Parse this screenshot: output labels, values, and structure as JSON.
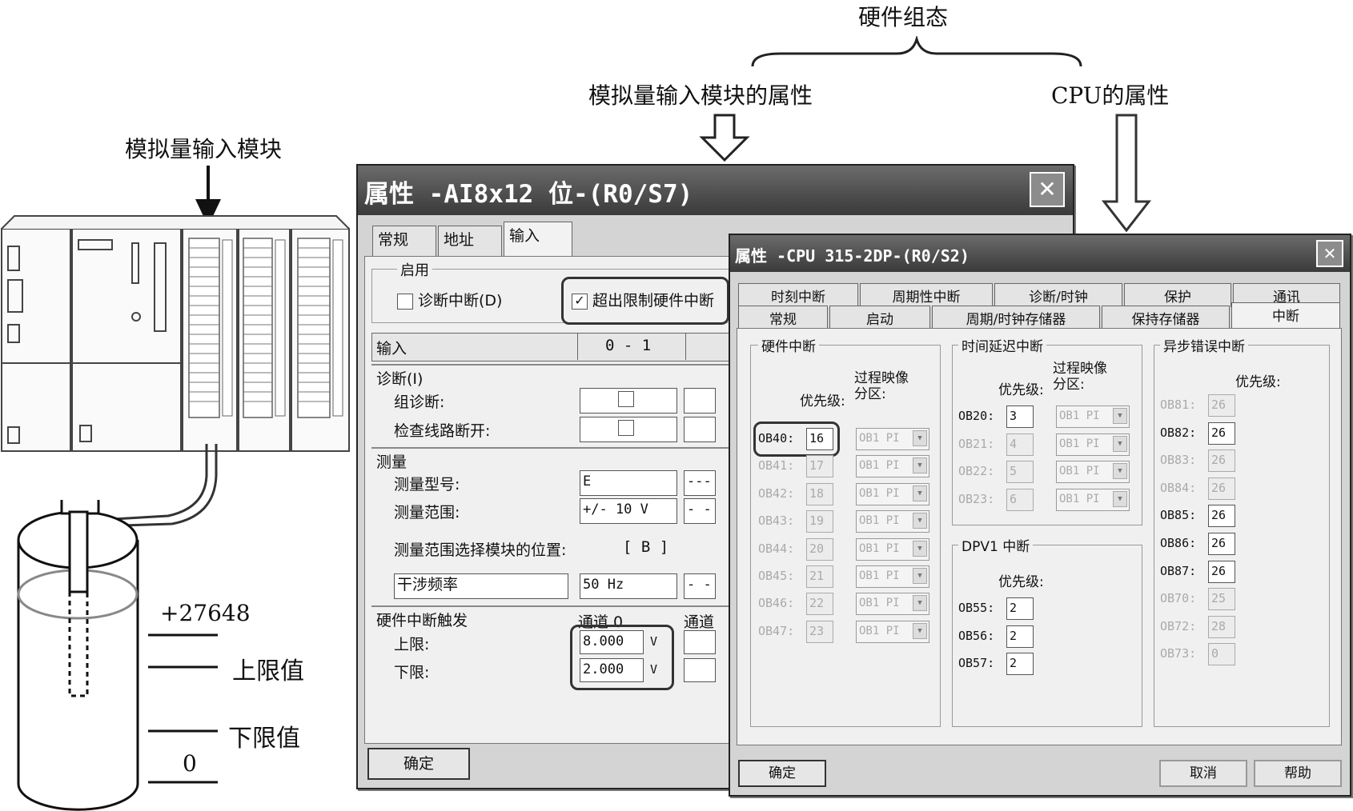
{
  "annotations": {
    "hw_config": "硬件组态",
    "ai_props": "模拟量输入模块的属性",
    "cpu_props": "CPU的属性",
    "ai_module": "模拟量输入模块",
    "val_max": "+27648",
    "upper": "上限值",
    "lower": "下限值",
    "zero": "0"
  },
  "ai_dialog": {
    "title": "属性 -AI8x12 位-(R0/S7)",
    "close": "✕",
    "tabs": [
      "常规",
      "地址",
      "输入"
    ],
    "enable_group": "启用",
    "diag_interrupt": "诊断中断(D)",
    "limit_interrupt": "超出限制硬件中断",
    "check_mark": "✓",
    "input_header": "输入",
    "channel_header": "0 - 1",
    "diag_section": "诊断(I)",
    "group_diag": "组诊断:",
    "wire_break": "检查线路断开:",
    "measure_section": "测量",
    "measure_type": "测量型号:",
    "measure_type_val": "E",
    "measure_type_val2": "---",
    "measure_range": "测量范围:",
    "measure_range_val": "+/- 10 V",
    "measure_range_val2": "- -",
    "range_module_pos": "测量范围选择模块的位置:",
    "range_module_val": "[ B ]",
    "interference": "干涉频率",
    "interference_val": "50 Hz",
    "interference_val2": "- -",
    "hw_trigger": "硬件中断触发",
    "channel0": "通道 0",
    "channel_next": "通道",
    "upper_label": "上限:",
    "upper_val": "8.000",
    "lower_label": "下限:",
    "lower_val": "2.000",
    "unit": "V",
    "ok": "确定"
  },
  "cpu_dialog": {
    "title": "属性 -CPU 315-2DP-(R0/S2)",
    "close": "✕",
    "tabs_row1": [
      "时刻中断",
      "周期性中断",
      "诊断/时钟",
      "保护",
      "通讯"
    ],
    "tabs_row2": [
      "常规",
      "启动",
      "周期/时钟存储器",
      "保持存储器",
      "中断"
    ],
    "hw_group": "硬件中断",
    "priority": "优先级:",
    "process_image": "过程映像分区:",
    "hw_rows": [
      {
        "ob": "OB40:",
        "val": "16",
        "pi": "OB1 PI",
        "enabled": true
      },
      {
        "ob": "OB41:",
        "val": "17",
        "pi": "OB1 PI",
        "enabled": false
      },
      {
        "ob": "OB42:",
        "val": "18",
        "pi": "OB1 PI",
        "enabled": false
      },
      {
        "ob": "OB43:",
        "val": "19",
        "pi": "OB1 PI",
        "enabled": false
      },
      {
        "ob": "OB44:",
        "val": "20",
        "pi": "OB1 PI",
        "enabled": false
      },
      {
        "ob": "OB45:",
        "val": "21",
        "pi": "OB1 PI",
        "enabled": false
      },
      {
        "ob": "OB46:",
        "val": "22",
        "pi": "OB1 PI",
        "enabled": false
      },
      {
        "ob": "OB47:",
        "val": "23",
        "pi": "OB1 PI",
        "enabled": false
      }
    ],
    "delay_group": "时间延迟中断",
    "delay_rows": [
      {
        "ob": "OB20:",
        "val": "3",
        "pi": "OB1 PI",
        "enabled": true
      },
      {
        "ob": "OB21:",
        "val": "4",
        "pi": "OB1 PI",
        "enabled": false
      },
      {
        "ob": "OB22:",
        "val": "5",
        "pi": "OB1 PI",
        "enabled": false
      },
      {
        "ob": "OB23:",
        "val": "6",
        "pi": "OB1 PI",
        "enabled": false
      }
    ],
    "dpv1_group": "DPV1 中断",
    "dpv1_rows": [
      {
        "ob": "OB55:",
        "val": "2",
        "enabled": true
      },
      {
        "ob": "OB56:",
        "val": "2",
        "enabled": true
      },
      {
        "ob": "OB57:",
        "val": "2",
        "enabled": true
      }
    ],
    "async_group": "异步错误中断",
    "async_rows": [
      {
        "ob": "OB81:",
        "val": "26",
        "enabled": false
      },
      {
        "ob": "OB82:",
        "val": "26",
        "enabled": true
      },
      {
        "ob": "OB83:",
        "val": "26",
        "enabled": false
      },
      {
        "ob": "OB84:",
        "val": "26",
        "enabled": false
      },
      {
        "ob": "OB85:",
        "val": "26",
        "enabled": true
      },
      {
        "ob": "OB86:",
        "val": "26",
        "enabled": true
      },
      {
        "ob": "OB87:",
        "val": "26",
        "enabled": true
      },
      {
        "ob": "OB70:",
        "val": "25",
        "enabled": false
      },
      {
        "ob": "OB72:",
        "val": "28",
        "enabled": false
      },
      {
        "ob": "OB73:",
        "val": "0",
        "enabled": false
      }
    ],
    "ok": "确定",
    "cancel": "取消",
    "help": "帮助"
  }
}
